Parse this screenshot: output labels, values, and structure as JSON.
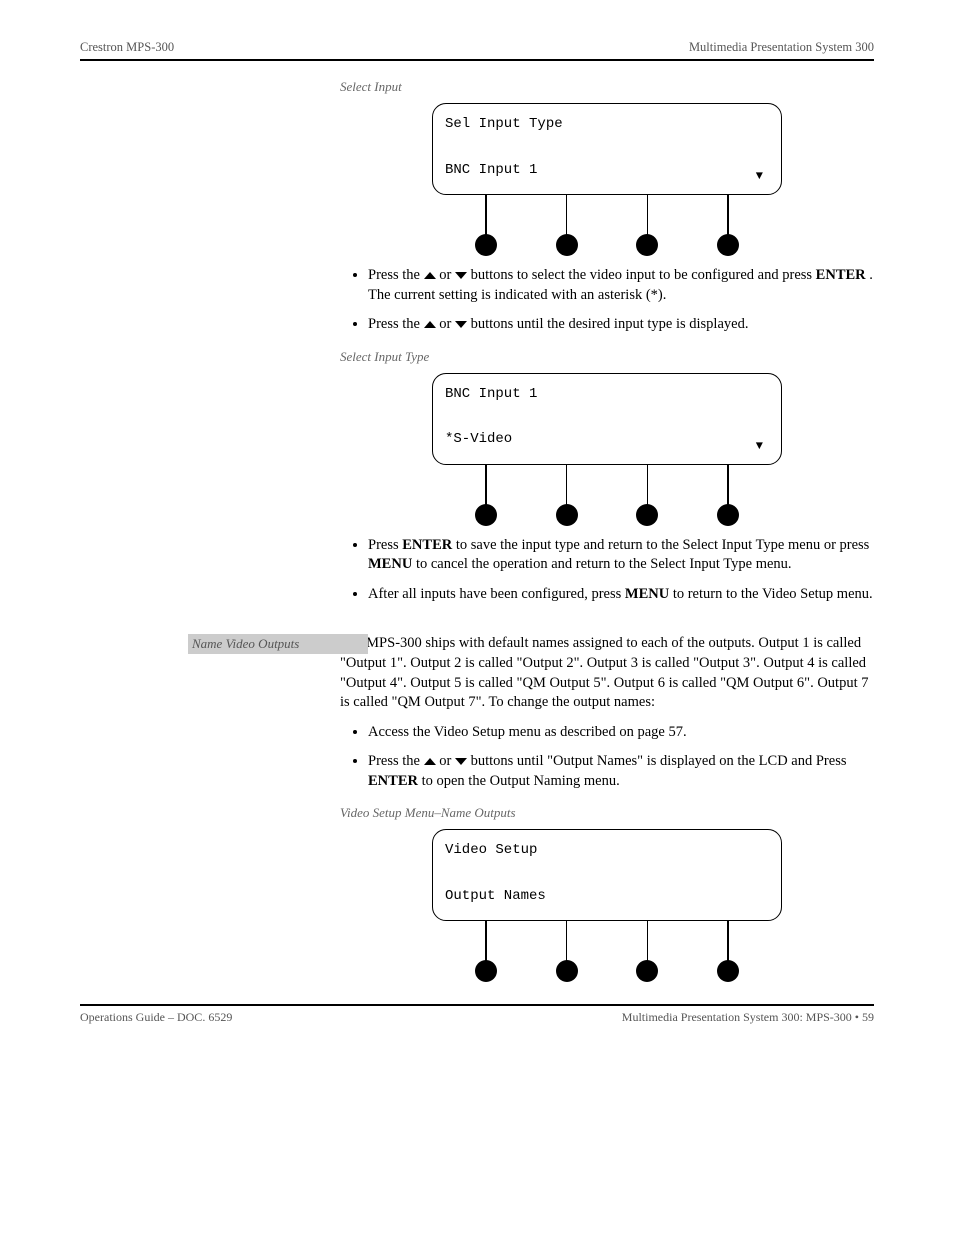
{
  "header": {
    "left": "Crestron MPS-300",
    "right": "Multimedia Presentation System 300"
  },
  "lcd1": {
    "title": "Select Input",
    "line1": "Sel Input Type",
    "line2": "BNC Input 1",
    "arrow": "▼"
  },
  "bullets1": [
    {
      "pre": "Press the ",
      "mid": " or ",
      "post": " buttons to select the video input to be configured and press ",
      "bold1": "ENTER",
      "tail": ". The current setting is indicated with an asterisk (*)."
    },
    {
      "pre": "Press the ",
      "mid": " or ",
      "post": " buttons until the desired input type is displayed.",
      "bold1": "",
      "tail": ""
    }
  ],
  "lcd2": {
    "title": "Select Input Type",
    "line1": "BNC Input 1",
    "line2": "*S-Video",
    "arrow": "▼"
  },
  "bullets2": [
    {
      "pre": "Press ",
      "b1": "ENTER",
      "mid": " to save the input type and return to the Select Input Type menu or press ",
      "b2": "MENU",
      "tail": " to cancel the operation and return to the Select Input Type menu."
    },
    {
      "pre": "After all inputs have been configured, press ",
      "b1": "MENU",
      "mid": " to return to the Video Setup menu.",
      "b2": "",
      "tail": ""
    }
  ],
  "sidebar": {
    "nameOutputs": "Name Video Outputs"
  },
  "para": "The MPS-300 ships with default names assigned to each of the outputs. Output 1 is called \"Output 1\". Output 2 is called \"Output 2\". Output 3 is called \"Output 3\". Output 4 is called \"Output 4\". Output 5 is called \"QM Output 5\". Output 6 is called \"QM Output 6\". Output 7 is called \"QM Output 7\". To change the output names:",
  "bullets3": [
    {
      "text": "Access the Video Setup menu as described on page 57."
    },
    {
      "pre": "Press the ",
      "mid": " or ",
      "post": " buttons until \"Output Names\" is displayed on the LCD and Press ",
      "b1": "ENTER",
      "tail": " to open the Output Naming menu."
    }
  ],
  "lcd3": {
    "title": "Video Setup Menu–Name Outputs",
    "line1": "Video Setup",
    "line2": "Output Names"
  },
  "footer": {
    "left": "Operations Guide – DOC. 6529",
    "right": "Multimedia Presentation System 300: MPS-300 • 59"
  }
}
